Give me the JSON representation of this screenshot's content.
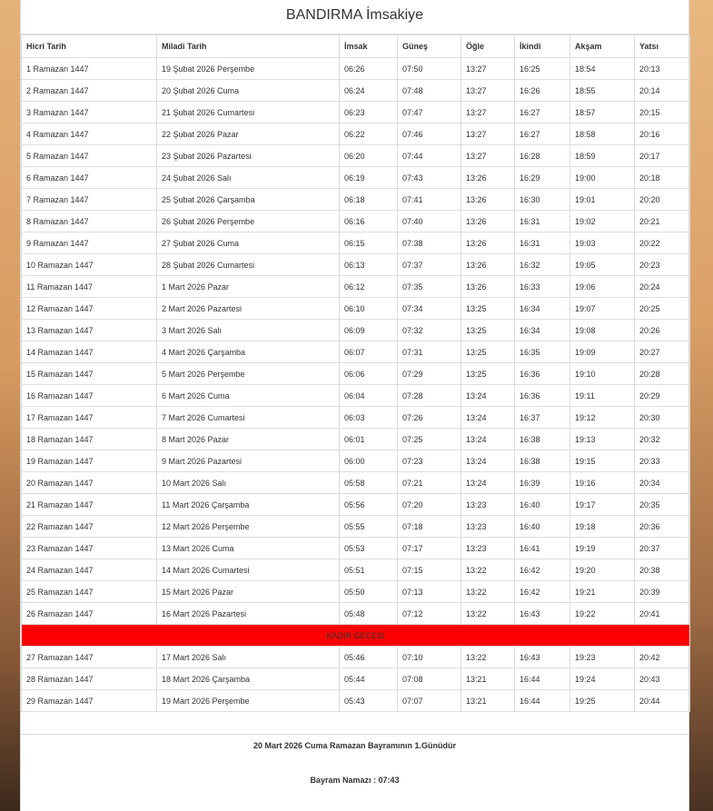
{
  "title": "BANDIRMA İmsakiye",
  "columns": [
    "Hicri Tarih",
    "Miladi Tarih",
    "İmsak",
    "Güneş",
    "Öğle",
    "İkindi",
    "Akşam",
    "Yatsı"
  ],
  "rows_before": [
    [
      "1 Ramazan 1447",
      "19 Şubat 2026 Perşembe",
      "06:26",
      "07:50",
      "13:27",
      "16:25",
      "18:54",
      "20:13"
    ],
    [
      "2 Ramazan 1447",
      "20 Şubat 2026 Cuma",
      "06:24",
      "07:48",
      "13:27",
      "16:26",
      "18:55",
      "20:14"
    ],
    [
      "3 Ramazan 1447",
      "21 Şubat 2026 Cumartesi",
      "06:23",
      "07:47",
      "13:27",
      "16:27",
      "18:57",
      "20:15"
    ],
    [
      "4 Ramazan 1447",
      "22 Şubat 2026 Pazar",
      "06:22",
      "07:46",
      "13:27",
      "16:27",
      "18:58",
      "20:16"
    ],
    [
      "5 Ramazan 1447",
      "23 Şubat 2026 Pazartesi",
      "06:20",
      "07:44",
      "13:27",
      "16:28",
      "18:59",
      "20:17"
    ],
    [
      "6 Ramazan 1447",
      "24 Şubat 2026 Salı",
      "06:19",
      "07:43",
      "13:26",
      "16:29",
      "19:00",
      "20:18"
    ],
    [
      "7 Ramazan 1447",
      "25 Şubat 2026 Çarşamba",
      "06:18",
      "07:41",
      "13:26",
      "16:30",
      "19:01",
      "20:20"
    ],
    [
      "8 Ramazan 1447",
      "26 Şubat 2026 Perşembe",
      "06:16",
      "07:40",
      "13:26",
      "16:31",
      "19:02",
      "20:21"
    ],
    [
      "9 Ramazan 1447",
      "27 Şubat 2026 Cuma",
      "06:15",
      "07:38",
      "13:26",
      "16:31",
      "19:03",
      "20:22"
    ],
    [
      "10 Ramazan 1447",
      "28 Şubat 2026 Cumartesi",
      "06:13",
      "07:37",
      "13:26",
      "16:32",
      "19:05",
      "20:23"
    ],
    [
      "11 Ramazan 1447",
      "1 Mart 2026 Pazar",
      "06:12",
      "07:35",
      "13:26",
      "16:33",
      "19:06",
      "20:24"
    ],
    [
      "12 Ramazan 1447",
      "2 Mart 2026 Pazartesi",
      "06:10",
      "07:34",
      "13:25",
      "16:34",
      "19:07",
      "20:25"
    ],
    [
      "13 Ramazan 1447",
      "3 Mart 2026 Salı",
      "06:09",
      "07:32",
      "13:25",
      "16:34",
      "19:08",
      "20:26"
    ],
    [
      "14 Ramazan 1447",
      "4 Mart 2026 Çarşamba",
      "06:07",
      "07:31",
      "13:25",
      "16:35",
      "19:09",
      "20:27"
    ],
    [
      "15 Ramazan 1447",
      "5 Mart 2026 Perşembe",
      "06:06",
      "07:29",
      "13:25",
      "16:36",
      "19:10",
      "20:28"
    ],
    [
      "16 Ramazan 1447",
      "6 Mart 2026 Cuma",
      "06:04",
      "07:28",
      "13:24",
      "16:36",
      "19:11",
      "20:29"
    ],
    [
      "17 Ramazan 1447",
      "7 Mart 2026 Cumartesi",
      "06:03",
      "07:26",
      "13:24",
      "16:37",
      "19:12",
      "20:30"
    ],
    [
      "18 Ramazan 1447",
      "8 Mart 2026 Pazar",
      "06:01",
      "07:25",
      "13:24",
      "16:38",
      "19:13",
      "20:32"
    ],
    [
      "19 Ramazan 1447",
      "9 Mart 2026 Pazartesi",
      "06:00",
      "07:23",
      "13:24",
      "16:38",
      "19:15",
      "20:33"
    ],
    [
      "20 Ramazan 1447",
      "10 Mart 2026 Salı",
      "05:58",
      "07:21",
      "13:24",
      "16:39",
      "19:16",
      "20:34"
    ],
    [
      "21 Ramazan 1447",
      "11 Mart 2026 Çarşamba",
      "05:56",
      "07:20",
      "13:23",
      "16:40",
      "19:17",
      "20:35"
    ],
    [
      "22 Ramazan 1447",
      "12 Mart 2026 Perşembe",
      "05:55",
      "07:18",
      "13:23",
      "16:40",
      "19:18",
      "20:36"
    ],
    [
      "23 Ramazan 1447",
      "13 Mart 2026 Cuma",
      "05:53",
      "07:17",
      "13:23",
      "16:41",
      "19:19",
      "20:37"
    ],
    [
      "24 Ramazan 1447",
      "14 Mart 2026 Cumartesi",
      "05:51",
      "07:15",
      "13:22",
      "16:42",
      "19:20",
      "20:38"
    ],
    [
      "25 Ramazan 1447",
      "15 Mart 2026 Pazar",
      "05:50",
      "07:13",
      "13:22",
      "16:42",
      "19:21",
      "20:39"
    ],
    [
      "26 Ramazan 1447",
      "16 Mart 2026 Pazartesi",
      "05:48",
      "07:12",
      "13:22",
      "16:43",
      "19:22",
      "20:41"
    ]
  ],
  "kadir_label": "KADİR GECESİ",
  "highlight_color": "#ff0000",
  "rows_after": [
    [
      "27 Ramazan 1447",
      "17 Mart 2026 Salı",
      "05:46",
      "07:10",
      "13:22",
      "16:43",
      "19:23",
      "20:42"
    ],
    [
      "28 Ramazan 1447",
      "18 Mart 2026 Çarşamba",
      "05:44",
      "07:08",
      "13:21",
      "16:44",
      "19:24",
      "20:43"
    ],
    [
      "29 Ramazan 1447",
      "19 Mart 2026 Perşembe",
      "05:43",
      "07:07",
      "13:21",
      "16:44",
      "19:25",
      "20:44"
    ]
  ],
  "bayram_text": "20 Mart 2026 Cuma Ramazan Bayramının 1.Günüdür",
  "namaz_text": "Bayram Namazı : 07:43"
}
